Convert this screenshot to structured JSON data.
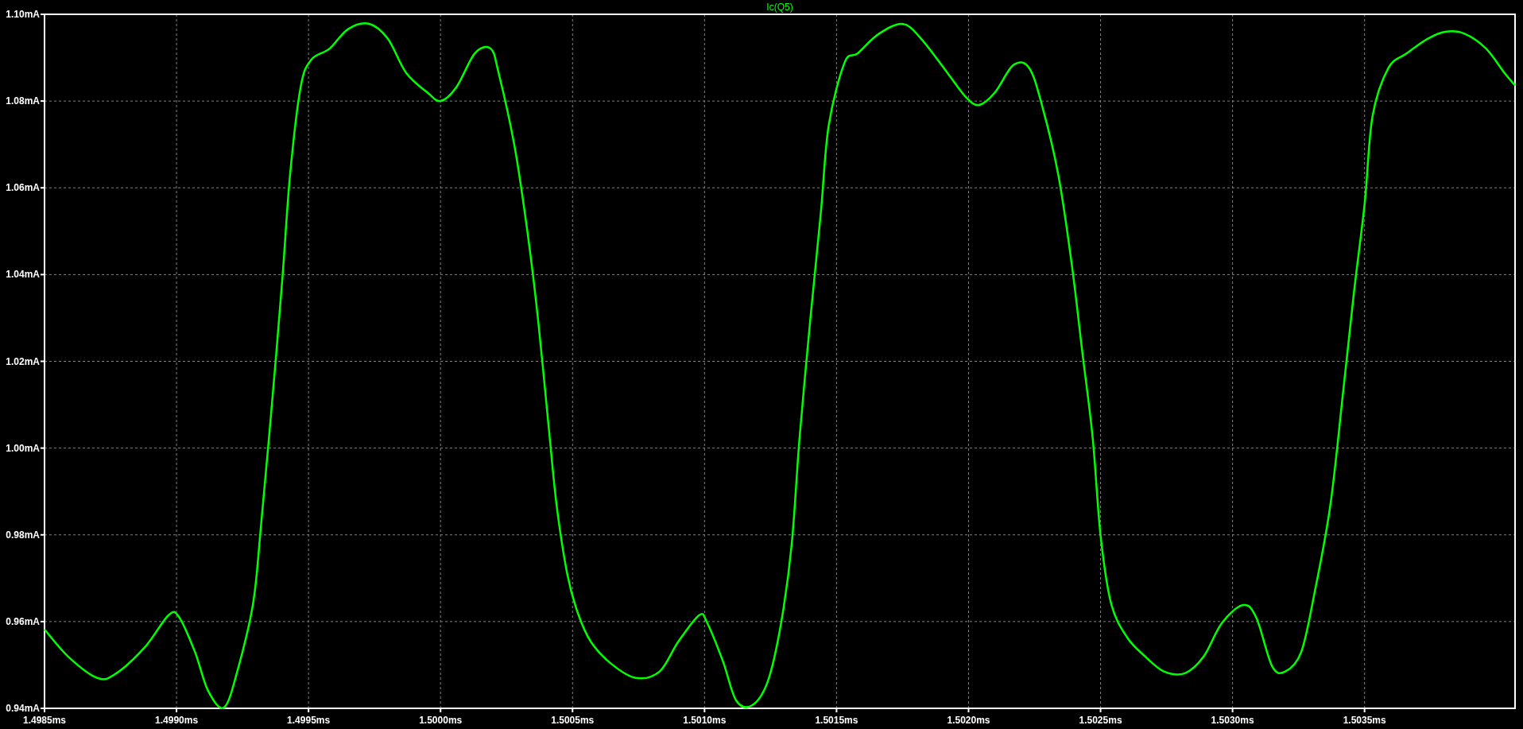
{
  "chart_data": {
    "type": "line",
    "grid": true,
    "xlim": [
      1.4985,
      1.50407
    ],
    "ylim": [
      0.94,
      1.1
    ],
    "xticks": [
      {
        "value": 1.4985,
        "label": "1.4985ms"
      },
      {
        "value": 1.499,
        "label": "1.4990ms"
      },
      {
        "value": 1.4995,
        "label": "1.4995ms"
      },
      {
        "value": 1.5,
        "label": "1.5000ms"
      },
      {
        "value": 1.5005,
        "label": "1.5005ms"
      },
      {
        "value": 1.501,
        "label": "1.5010ms"
      },
      {
        "value": 1.5015,
        "label": "1.5015ms"
      },
      {
        "value": 1.502,
        "label": "1.5020ms"
      },
      {
        "value": 1.5025,
        "label": "1.5025ms"
      },
      {
        "value": 1.503,
        "label": "1.5030ms"
      },
      {
        "value": 1.5035,
        "label": "1.5035ms"
      }
    ],
    "yticks": [
      {
        "value": 0.94,
        "label": "0.94mA"
      },
      {
        "value": 0.96,
        "label": "0.96mA"
      },
      {
        "value": 0.98,
        "label": "0.98mA"
      },
      {
        "value": 1.0,
        "label": "1.00mA"
      },
      {
        "value": 1.02,
        "label": "1.02mA"
      },
      {
        "value": 1.04,
        "label": "1.04mA"
      },
      {
        "value": 1.06,
        "label": "1.06mA"
      },
      {
        "value": 1.08,
        "label": "1.08mA"
      },
      {
        "value": 1.1,
        "label": "1.10mA"
      }
    ],
    "x": [
      1.4985,
      1.49859,
      1.4987,
      1.49877,
      1.49888,
      1.49897,
      1.49901,
      1.49907,
      1.49912,
      1.49918,
      1.49923,
      1.49929,
      1.49932,
      1.49936,
      1.4994,
      1.49943,
      1.49947,
      1.49951,
      1.49958,
      1.49965,
      1.49973,
      1.4998,
      1.49987,
      1.49995,
      1.5,
      1.50006,
      1.50013,
      1.50019,
      1.50022,
      1.50028,
      1.50033,
      1.50037,
      1.50041,
      1.50044,
      1.50048,
      1.50052,
      1.50057,
      1.50065,
      1.50074,
      1.50083,
      1.5009,
      1.50098,
      1.50101,
      1.50107,
      1.50112,
      1.50118,
      1.50124,
      1.50129,
      1.50133,
      1.50136,
      1.5014,
      1.50144,
      1.50147,
      1.50153,
      1.50158,
      1.50166,
      1.50175,
      1.50182,
      1.50192,
      1.50199,
      1.50204,
      1.5021,
      1.50217,
      1.50223,
      1.50228,
      1.50234,
      1.50239,
      1.50243,
      1.50247,
      1.5025,
      1.50254,
      1.5026,
      1.50267,
      1.50274,
      1.50282,
      1.50289,
      1.50296,
      1.50304,
      1.50309,
      1.50315,
      1.5032,
      1.50326,
      1.50331,
      1.50337,
      1.50342,
      1.50346,
      1.5035,
      1.50353,
      1.50359,
      1.50366,
      1.50374,
      1.50381,
      1.50388,
      1.50396,
      1.50403,
      1.50407
    ],
    "series": [
      {
        "name": "Ic(Q5)",
        "color": "#00ff00",
        "values": [
          0.9582,
          0.9519,
          0.947,
          0.948,
          0.9541,
          0.9615,
          0.961,
          0.953,
          0.944,
          0.9402,
          0.9485,
          0.9642,
          0.9822,
          1.0091,
          1.0383,
          1.063,
          1.0832,
          1.0895,
          1.0921,
          1.0966,
          1.0978,
          1.0944,
          1.0865,
          1.082,
          1.08,
          1.0832,
          1.091,
          1.0921,
          1.0865,
          1.0697,
          1.0495,
          1.0293,
          1.0046,
          0.9867,
          0.971,
          0.962,
          0.9553,
          0.9501,
          0.947,
          0.9485,
          0.9553,
          0.9615,
          0.9597,
          0.9508,
          0.9418,
          0.9407,
          0.9463,
          0.9597,
          0.9777,
          1.0024,
          1.0293,
          1.054,
          1.0742,
          1.0888,
          1.091,
          1.0955,
          1.0978,
          1.0944,
          1.0865,
          1.0809,
          1.0791,
          1.082,
          1.0883,
          1.0876,
          1.0786,
          1.063,
          1.0428,
          1.0226,
          1.0024,
          0.9799,
          0.9642,
          0.9564,
          0.9519,
          0.9485,
          0.9481,
          0.9519,
          0.9597,
          0.9638,
          0.9609,
          0.9497,
          0.9485,
          0.953,
          0.9665,
          0.9867,
          1.0136,
          1.036,
          1.0562,
          1.0764,
          1.0876,
          1.091,
          1.0944,
          1.096,
          1.0955,
          1.0921,
          1.0865,
          1.0836
        ]
      }
    ]
  }
}
